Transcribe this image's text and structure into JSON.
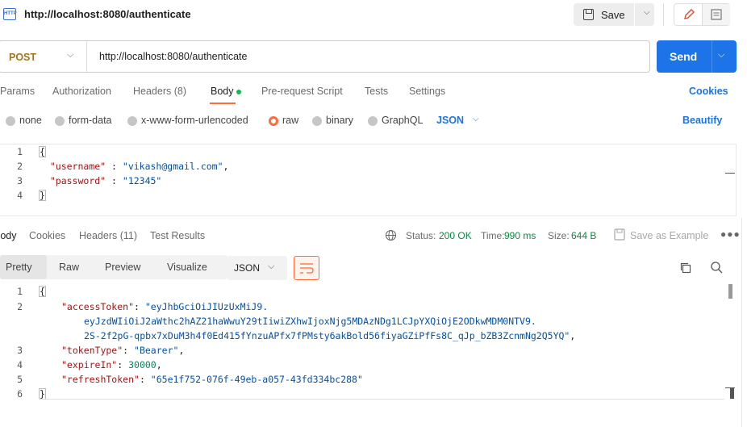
{
  "tab": {
    "title": "http://localhost:8080/authenticate",
    "protocol_badge": "HTTP"
  },
  "toolbar": {
    "save_label": "Save"
  },
  "request": {
    "method": "POST",
    "url": "http://localhost:8080/authenticate",
    "send_label": "Send",
    "tabs": [
      "Params",
      "Authorization",
      "Headers (8)",
      "Body",
      "Pre-request Script",
      "Tests",
      "Settings"
    ],
    "active_tab": "Body",
    "cookies_label": "Cookies",
    "body_types": [
      "none",
      "form-data",
      "x-www-form-urlencoded",
      "raw",
      "binary",
      "GraphQL"
    ],
    "selected_body_type": "raw",
    "format": "JSON",
    "beautify_label": "Beautify",
    "line_numbers": [
      "1",
      "2",
      "3",
      "4"
    ],
    "body_lines": {
      "open": "{",
      "username_key": "\"username\"",
      "username_val": "\"vikash@gmail.com\"",
      "password_key": "\"password\"",
      "password_val": "\"12345\"",
      "close": "}"
    }
  },
  "response": {
    "tabs": [
      "Body",
      "Cookies",
      "Headers (11)",
      "Test Results"
    ],
    "active_tab": "Body",
    "status_label": "Status:",
    "status_value": "200 OK",
    "time_label": "Time:",
    "time_value": "990 ms",
    "size_label": "Size:",
    "size_value": "644 B",
    "save_example_label": "Save as Example",
    "view_modes": [
      "Pretty",
      "Raw",
      "Preview",
      "Visualize"
    ],
    "active_view": "Pretty",
    "format": "JSON",
    "line_numbers": [
      "1",
      "2",
      "3",
      "4",
      "5",
      "6"
    ],
    "body_lines": {
      "open": "{",
      "accessToken_key": "\"accessToken\"",
      "accessToken_val_1": "\"eyJhbGciOiJIUzUxMiJ9.",
      "accessToken_val_2": "eyJzdWIiOiJ2aWthc2hAZ21haWwuY29tIiwiZXhwIjoxNjg5MDAzNDg1LCJpYXQiOjE2ODkwMDM0NTV9.",
      "accessToken_val_3": "2S-2f2pG-qpbx7xDuM3h4f0Ed415fYnzuAPfx7fPMsty6akBold56fiyaGZiPfFs8C_qJp_bZB3ZcnmNg2Q5YQ\"",
      "tokenType_key": "\"tokenType\"",
      "tokenType_val": "\"Bearer\"",
      "expireIn_key": "\"expireIn\"",
      "expireIn_val": "30000",
      "refreshToken_key": "\"refreshToken\"",
      "refreshToken_val": "\"65e1f752-076f-49eb-a057-43fd334bc288\"",
      "close": "}"
    }
  },
  "colors": {
    "accent": "#ff6c37",
    "primary": "#1d73e8",
    "status_ok": "#0a8a3d"
  },
  "icons": [
    "http-icon",
    "save-disk-icon",
    "chevron-down-icon",
    "pencil-icon",
    "document-icon",
    "globe-icon",
    "save-example-icon",
    "more-icon",
    "wrap-lines-icon",
    "copy-icon",
    "search-icon"
  ]
}
